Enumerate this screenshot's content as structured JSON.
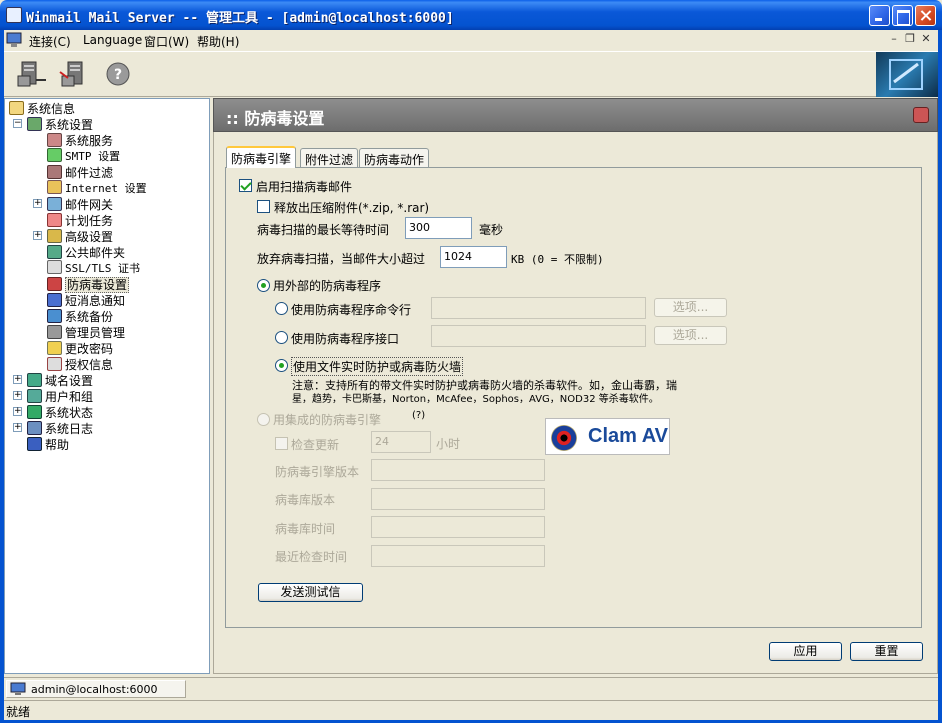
{
  "window": {
    "title": "Winmail Mail Server -- 管理工具 - [admin@localhost:6000]"
  },
  "menu": {
    "items": [
      "连接(C)",
      "Language",
      "窗口(W)",
      "帮助(H)"
    ]
  },
  "tree": {
    "items": [
      {
        "label": "系统信息"
      },
      {
        "label": "系统设置"
      },
      {
        "label": "系统服务"
      },
      {
        "label": "SMTP 设置"
      },
      {
        "label": "邮件过滤"
      },
      {
        "label": "Internet 设置"
      },
      {
        "label": "邮件网关"
      },
      {
        "label": "计划任务"
      },
      {
        "label": "高级设置"
      },
      {
        "label": "公共邮件夹"
      },
      {
        "label": "SSL/TLS 证书"
      },
      {
        "label": "防病毒设置"
      },
      {
        "label": "短消息通知"
      },
      {
        "label": "系统备份"
      },
      {
        "label": "管理员管理"
      },
      {
        "label": "更改密码"
      },
      {
        "label": "授权信息"
      },
      {
        "label": "域名设置"
      },
      {
        "label": "用户和组"
      },
      {
        "label": "系统状态"
      },
      {
        "label": "系统日志"
      },
      {
        "label": "帮助"
      }
    ]
  },
  "panel": {
    "title": ":: 防病毒设置",
    "tabs": [
      "防病毒引擎",
      "附件过滤",
      "防病毒动作"
    ],
    "enable_scan": {
      "label": "启用扫描病毒邮件",
      "checked": true
    },
    "extract_archives": {
      "label": "释放出压缩附件(*.zip, *.rar)",
      "checked": false
    },
    "max_wait": {
      "label": "病毒扫描的最长等待时间",
      "value": "300",
      "unit": "毫秒"
    },
    "skip_size": {
      "label": "放弃病毒扫描，当邮件大小超过",
      "value": "1024",
      "unit": "KB  (0 = 不限制)"
    },
    "external": {
      "label": "用外部的防病毒程序",
      "checked": true
    },
    "cmdline": {
      "label": "使用防病毒程序命令行",
      "value": "",
      "button": "选项..."
    },
    "iface": {
      "label": "使用防病毒程序接口",
      "value": "",
      "button": "选项..."
    },
    "realtime": {
      "label": "使用文件实时防护或病毒防火墙",
      "checked": true
    },
    "note": {
      "line1": "注意：支持所有的带文件实时防护或病毒防火墙的杀毒软件。如，金山毒霸，瑞",
      "line2": "星，趋势，卡巴斯基，Norton，McAfee，Sophos，AVG，NOD32 等杀毒软件。"
    },
    "integrated": {
      "label": "用集成的防病毒引擎",
      "hint": "(?)",
      "logo_text": "Clam AV"
    },
    "check_update": {
      "label": "检查更新",
      "value": "24",
      "unit": "小时"
    },
    "engine_version": {
      "label": "防病毒引擎版本",
      "value": ""
    },
    "db_version": {
      "label": "病毒库版本",
      "value": ""
    },
    "db_time": {
      "label": "病毒库时间",
      "value": ""
    },
    "last_check": {
      "label": "最近检查时间",
      "value": ""
    },
    "send_test": "发送测试信",
    "apply": "应用",
    "reset": "重置"
  },
  "taskbar": {
    "item": "admin@localhost:6000"
  },
  "status": {
    "text": "就绪"
  }
}
